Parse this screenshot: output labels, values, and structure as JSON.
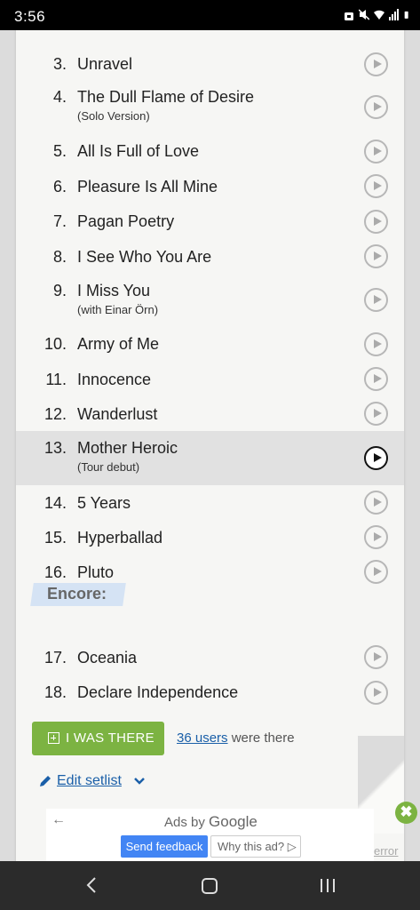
{
  "status_bar": {
    "time": "3:56",
    "icons": [
      "lock-icon",
      "mute-icon",
      "wifi-icon",
      "signal-icon",
      "battery-icon"
    ]
  },
  "setlist": [
    {
      "num": "3.",
      "title": "Unravel",
      "sub": ""
    },
    {
      "num": "4.",
      "title": "The Dull Flame of Desire",
      "sub": "(Solo Version)"
    },
    {
      "num": "5.",
      "title": "All Is Full of Love",
      "sub": ""
    },
    {
      "num": "6.",
      "title": "Pleasure Is All Mine",
      "sub": ""
    },
    {
      "num": "7.",
      "title": "Pagan Poetry",
      "sub": ""
    },
    {
      "num": "8.",
      "title": "I See Who You Are",
      "sub": ""
    },
    {
      "num": "9.",
      "title": "I Miss You",
      "sub": "(with Einar Örn)"
    },
    {
      "num": "10.",
      "title": "Army of Me",
      "sub": ""
    },
    {
      "num": "11.",
      "title": "Innocence",
      "sub": ""
    },
    {
      "num": "12.",
      "title": "Wanderlust",
      "sub": ""
    },
    {
      "num": "13.",
      "title": "Mother Heroic",
      "sub": "(Tour debut)"
    },
    {
      "num": "14.",
      "title": "5 Years",
      "sub": ""
    },
    {
      "num": "15.",
      "title": "Hyperballad",
      "sub": ""
    },
    {
      "num": "16.",
      "title": "Pluto",
      "sub": ""
    }
  ],
  "encore": {
    "label": "Encore:",
    "songs": [
      {
        "num": "17.",
        "title": "Oceania",
        "sub": ""
      },
      {
        "num": "18.",
        "title": "Declare Independence",
        "sub": ""
      }
    ]
  },
  "actions": {
    "i_was_there": "I WAS THERE",
    "users_link": "36 users",
    "users_suffix": " were there",
    "edit_setlist": "Edit setlist"
  },
  "ad": {
    "back": "←",
    "ads_by": "Ads by ",
    "google": "Google",
    "send_feedback": "Send feedback",
    "why_this_ad": "Why this ad? ▷",
    "error_link": "error",
    "close": "✖"
  },
  "colors": {
    "accent_green": "#7cb342",
    "link_blue": "#1a5fa8",
    "highlight_row": "#e1e1e1",
    "encore_bg": "#d5e3f4"
  }
}
